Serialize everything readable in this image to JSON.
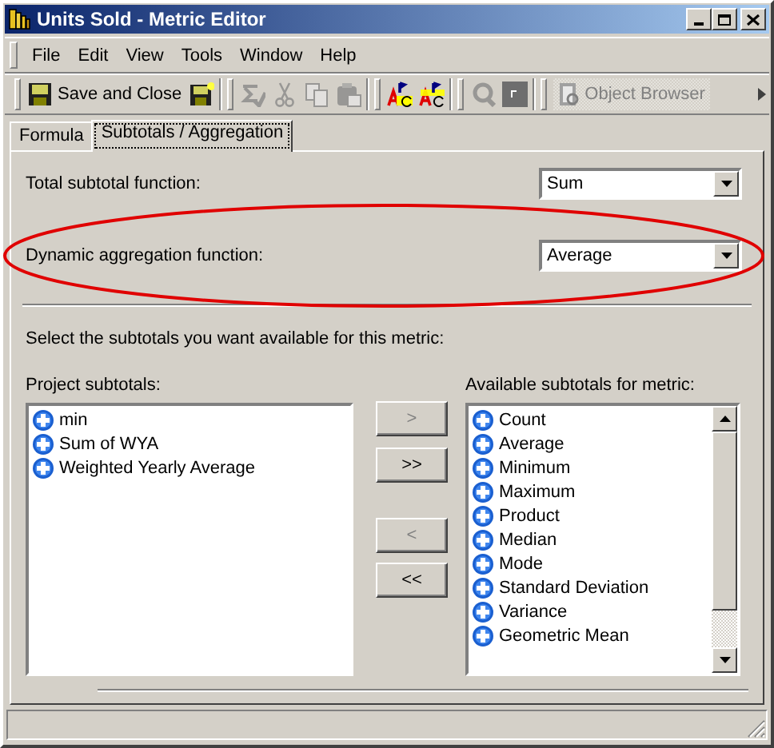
{
  "window": {
    "title": "Units Sold - Metric Editor"
  },
  "menu": [
    "File",
    "Edit",
    "View",
    "Tools",
    "Window",
    "Help"
  ],
  "toolbar": [
    {
      "kind": "save",
      "label": "Save and Close",
      "disabled": false
    },
    {
      "kind": "save-new",
      "disabled": false
    },
    {
      "kind": "separator"
    },
    {
      "kind": "sum",
      "disabled": true
    },
    {
      "kind": "cut",
      "disabled": true
    },
    {
      "kind": "copy",
      "disabled": true
    },
    {
      "kind": "paste",
      "disabled": true
    },
    {
      "kind": "separator"
    },
    {
      "kind": "spell",
      "disabled": false
    },
    {
      "kind": "spell-alt",
      "disabled": false
    },
    {
      "kind": "separator"
    },
    {
      "kind": "find",
      "disabled": true
    },
    {
      "kind": "stop",
      "disabled": false
    },
    {
      "kind": "separator"
    },
    {
      "kind": "browser",
      "label": "Object Browser",
      "disabled": true
    }
  ],
  "tabs": [
    {
      "label": "Formula",
      "selected": false
    },
    {
      "label": "Subtotals / Aggregation",
      "selected": true
    }
  ],
  "functions": [
    {
      "label": "Total subtotal function:",
      "value": "Sum",
      "highlighted": false
    },
    {
      "label": "Dynamic aggregation function:",
      "value": "Average",
      "highlighted": true
    }
  ],
  "instruction": "Select the subtotals you want available for this metric:",
  "project_subtotals": {
    "label": "Project subtotals:",
    "items": [
      "min",
      "Sum of WYA",
      "Weighted Yearly Average"
    ]
  },
  "transfer_buttons": [
    {
      "label": ">",
      "disabled": true
    },
    {
      "label": ">>",
      "disabled": false
    },
    {
      "label": "<",
      "disabled": true
    },
    {
      "label": "<<",
      "disabled": false
    }
  ],
  "available_subtotals": {
    "label": "Available subtotals for metric:",
    "items": [
      "Count",
      "Average",
      "Minimum",
      "Maximum",
      "Product",
      "Median",
      "Mode",
      "Standard Deviation",
      "Variance",
      "Geometric Mean"
    ]
  }
}
